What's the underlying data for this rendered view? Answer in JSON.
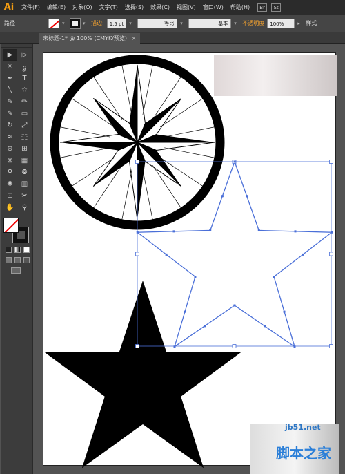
{
  "app": {
    "logo": "Ai"
  },
  "menu": {
    "items": [
      "文件(F)",
      "编辑(E)",
      "对象(O)",
      "文字(T)",
      "选择(S)",
      "效果(C)",
      "视图(V)",
      "窗口(W)",
      "帮助(H)"
    ],
    "icons": [
      "Br",
      "St"
    ]
  },
  "control_bar": {
    "selection_label": "路径",
    "stroke_label": "描边:",
    "stroke_weight": "1.5 pt",
    "profile_label": "等比",
    "brush_label": "基本",
    "opacity_label": "不透明度",
    "opacity_value": "100%",
    "style_label": "样式"
  },
  "document": {
    "tab_title": "未标题-1* @ 100% (CMYK/预览)",
    "close_glyph": "×"
  },
  "toolbox": {
    "tools": [
      "selection-tool",
      "direct-selection-tool",
      "magic-wand-tool",
      "lasso-tool",
      "pen-tool",
      "type-tool",
      "line-tool",
      "rectangle-tool",
      "paintbrush-tool",
      "pencil-tool",
      "blob-brush-tool",
      "eraser-tool",
      "rotate-tool",
      "scale-tool",
      "width-tool",
      "free-transform-tool",
      "shape-builder-tool",
      "perspective-grid-tool",
      "mesh-tool",
      "gradient-tool",
      "eyedropper-tool",
      "blend-tool",
      "symbol-sprayer-tool",
      "column-graph-tool",
      "artboard-tool",
      "slice-tool",
      "hand-tool",
      "zoom-tool"
    ],
    "glyphs": [
      "▶",
      "▷",
      "✴",
      "ℊ",
      "✒",
      "T",
      "╲",
      "☆",
      "✎",
      "✏",
      "✎",
      "▭",
      "↻",
      "⤢",
      "≈",
      "⬚",
      "⊕",
      "⊞",
      "⊠",
      "▦",
      "⚲",
      "⦾",
      "✺",
      "▥",
      "⊡",
      "✂",
      "✋",
      "⚲"
    ]
  },
  "colors": {
    "accent": "#f39c12",
    "selection_blue": "#4a6fd8",
    "fill": "#000000"
  },
  "watermark": {
    "site": "jb51.net",
    "name": "脚本之家"
  }
}
